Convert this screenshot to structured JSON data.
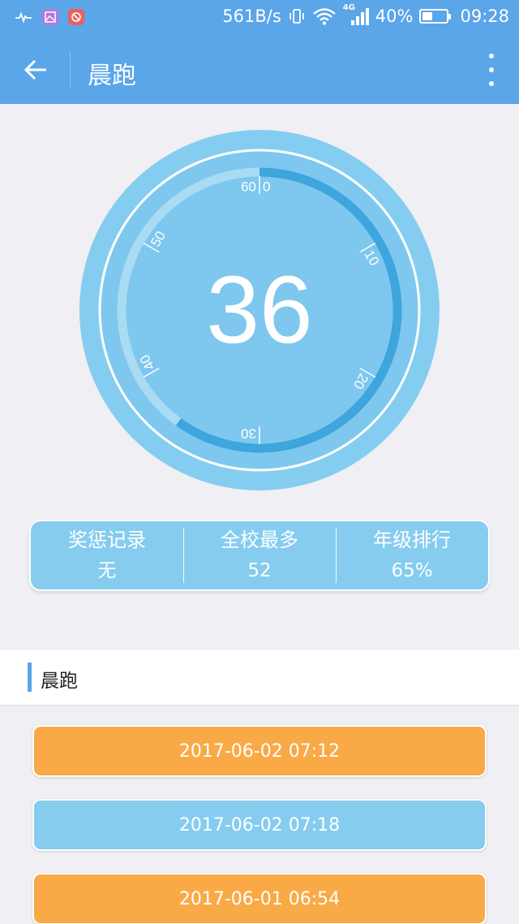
{
  "status_bar": {
    "net_speed": "561B/s",
    "network": "4G",
    "battery": "40%",
    "battery_level": 0.4,
    "time": "09:28",
    "icons": [
      "heartbeat-icon",
      "gallery-app-icon",
      "red-app-icon",
      "vibrate-icon",
      "wifi-icon",
      "signal-icon",
      "battery-icon"
    ]
  },
  "toolbar": {
    "title": "晨跑",
    "back_icon": "arrow-left-icon",
    "menu_icon": "more-vertical-icon"
  },
  "gauge": {
    "value": "36",
    "value_number": 36,
    "max": 60,
    "ticks": [
      "0",
      "10",
      "20",
      "30",
      "40",
      "50",
      "60"
    ],
    "colors": {
      "outer": "#84cdf0",
      "inner": "#7ec7ef",
      "track": "#a9dbf3",
      "progress": "#3ea5dd",
      "ring": "#ffffff"
    }
  },
  "stats": [
    {
      "label": "奖惩记录",
      "value": "无"
    },
    {
      "label": "全校最多",
      "value": "52"
    },
    {
      "label": "年级排行",
      "value": "65%"
    }
  ],
  "section": {
    "title": "晨跑"
  },
  "records": [
    {
      "time": "2017-06-02 07:12",
      "color": "#f9aa46"
    },
    {
      "time": "2017-06-02 07:18",
      "color": "#85ccef"
    },
    {
      "time": "2017-06-01 06:54",
      "color": "#f9aa46"
    }
  ],
  "colors": {
    "primary": "#5ba5e9",
    "background": "#efeff4"
  }
}
